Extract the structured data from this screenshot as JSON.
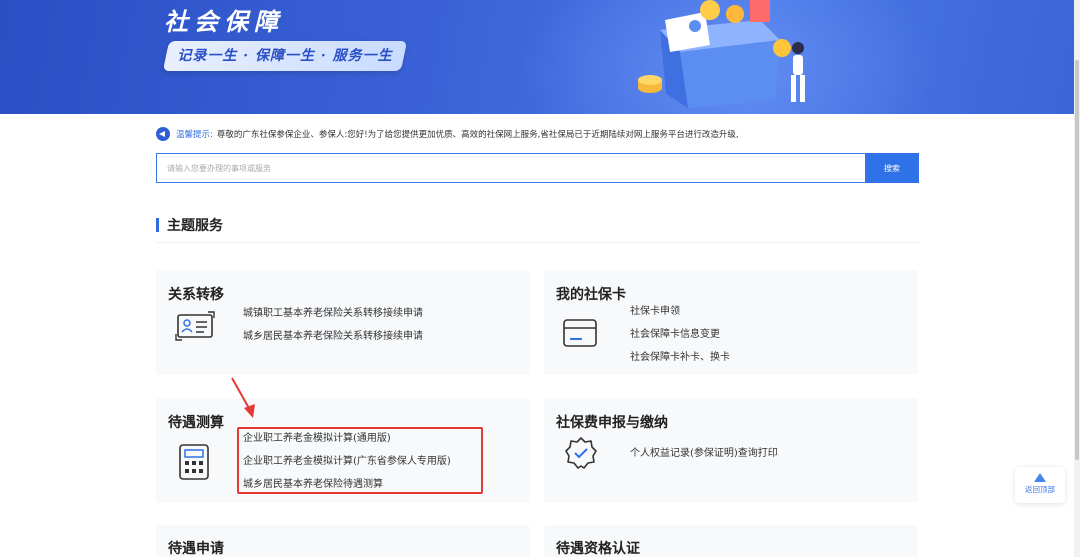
{
  "banner": {
    "title": "社会保障",
    "slogan": "记录一生 · 保障一生 · 服务一生"
  },
  "notice": {
    "label": "温馨提示:",
    "text": "尊敬的广东社保参保企业、参保人:您好!为了给您提供更加优质、高效的社保网上服务,省社保局已于近期陆续对网上服务平台进行改造升级,"
  },
  "search": {
    "placeholder": "请输入您要办理的事项或服务",
    "button_label": "搜索"
  },
  "section": {
    "title": "主题服务"
  },
  "cards": {
    "transfer": {
      "title": "关系转移",
      "icon": "id-card-transfer-icon",
      "links": [
        "城镇职工基本养老保险关系转移接续申请",
        "城乡居民基本养老保险关系转移接续申请"
      ]
    },
    "social_card": {
      "title": "我的社保卡",
      "icon": "bank-card-icon",
      "links": [
        "社保卡申领",
        "社会保障卡信息变更",
        "社会保障卡补卡、换卡"
      ]
    },
    "calc": {
      "title": "待遇测算",
      "icon": "calculator-icon",
      "links": [
        "企业职工养老金模拟计算(通用版)",
        "企业职工养老金模拟计算(广东省参保人专用版)",
        "城乡居民基本养老保险待遇测算"
      ]
    },
    "payment": {
      "title": "社保费申报与缴纳",
      "icon": "verified-badge-icon",
      "links": [
        "个人权益记录(参保证明)查询打印"
      ]
    },
    "apply": {
      "title": "待遇申请"
    },
    "qualify": {
      "title": "待遇资格认证"
    }
  },
  "back_to_top": {
    "label": "返回顶部",
    "icon": "arrow-up-icon"
  },
  "colors": {
    "primary": "#2f72e8",
    "banner": "#3a62d6",
    "highlight": "#e53935"
  }
}
